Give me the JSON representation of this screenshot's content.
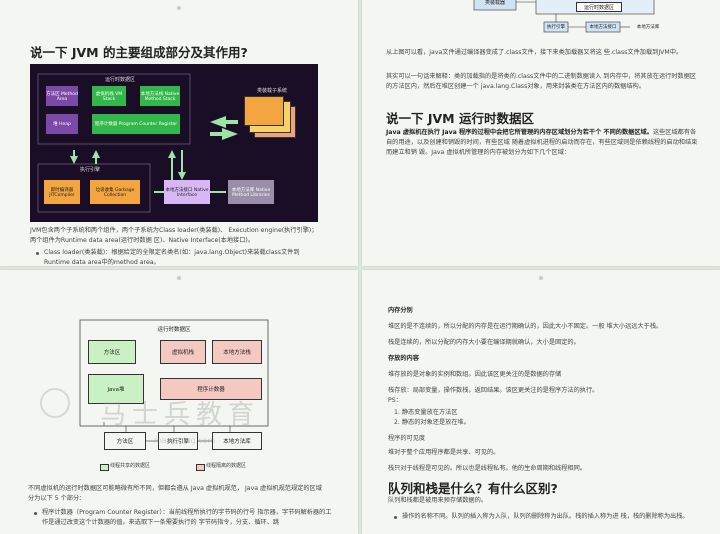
{
  "page1": {
    "title": "说一下 JVM 的主要组成部分及其作用?",
    "diagram": {
      "runtime_area": "运行时数据区",
      "method_area": "方法区 Method Area",
      "vm_stack": "虚拟机栈 VM Stack",
      "native_stack": "本地方法栈 Native Method Stack",
      "heap": "堆 Heap",
      "pc_register": "程序计数器 Program Counter Register",
      "class_loader": "类装载子系统",
      "exec_engine": "执行引擎",
      "jit": "即时编译器 JITCompiler",
      "gc": "垃圾收集 Garbage Collection",
      "native_interface": "本地方法接口 Native Interface",
      "native_lib": "本地方法库 Native Method Libraries"
    },
    "para": "JVM包含两个子系统和两个组件，两个子系统为Class loader(类装载)、 Execution engine(执行引擎)；两个组件为Runtime data area(运行时数据 区)、Native Interface(本地接口)。",
    "bullet": "Class loader(类装载)：根据给定的全限定名类名(如：java.lang.Object)来装载class文件到 Runtime data area中的method area。"
  },
  "page2": {
    "top_boxes": {
      "class_loader": "类装载器",
      "runtime": "运行时数据区",
      "exec": "执行引擎",
      "native_iface": "本地方法接口",
      "native_lib": "本地方法库"
    },
    "para1": "从上图可以看，java文件通过编译器变成了.class文件，接下来类加载器又将这 些.class文件加载到JVM中。",
    "para2": "其实可以一句话来解释：类的加载指的是将类的.class文件中的二进制数据读入 到内存中，将其放在运行时数据区的方法区内，然后在堆区创建一个 java.lang.Class对象，用来封装类在方法区内的数据结构。",
    "title": "说一下 JVM 运行时数据区",
    "para3_bold": "Java 虚拟机在执行 Java 程序的过程中会把它所管理的内存区域划分为若干个 不同的数据区域。",
    "para3": "这些区域都有各自的用途，以及创建和销毁的时间，有些区域 随着虚拟机进程的启动而存在，有些区域则是依赖线程的启动和结束而建立和销 毁。Java 虚拟机所管理的内存被划分为如下几个区域："
  },
  "page3": {
    "diagram": {
      "runtime_area": "运行时数据区",
      "method_area": "方法区",
      "vm_stack": "虚拟机栈",
      "native_stack": "本地方法栈",
      "heap": "Java堆",
      "pc": "程序计数器",
      "bottom_method": "方法区",
      "bottom_exec": "执行引擎",
      "bottom_native": "本地方法库",
      "legend_shared": "线程共享的数据区",
      "legend_private": "线程隔离的数据区"
    },
    "watermark": "马士兵教育",
    "watermark_url": "mashibing.com",
    "para": "不同虚拟机的运行时数据区可能略微有所不同，但都会遵从 Java 虚拟机规范， Java 虚拟机规范规定的区域分为以下 5 个部分：",
    "bullet": "程序计数器（Program Counter Register）：当前线程所执行的字节码的行号 指示器，字节码解析器的工作是通过改变这个计数器的值，来选取下一条需要执行的 字节码指令，分支、循环、跳"
  },
  "page4": {
    "h_mem": "内存分别",
    "l1": "堆区的是不连续的，所以分配的内存是在运行期确认的，因此大小不固定。一般 堆大小远远大于栈。",
    "l2": "栈是连续的，所以分配的内存大小要在编译期就确认，大小是固定的。",
    "h_store": "存放的内容",
    "l3": "堆存放的是对象的实例和数组。因此该区更关注的是数据的存储",
    "l4": "栈存放：局部变量，操作数栈，返回结果。该区更关注的是程序方法的执行。",
    "ps": "PS：",
    "n1": "1. 静态变量放在方法区",
    "n2": "2. 静态的对象还是放在堆。",
    "h_vis": "程序的可见度",
    "l5": "堆对于整个应用程序都是共享、可见的。",
    "l6": "栈只对于线程是可见的。所以也是线程私有。他的生命周期和线程相同。",
    "title": "队列和栈是什么？有什么区别?",
    "l7": "队列和栈都是被用来预存储数据的。",
    "bullet": "操作的名称不同。队列的插入称为入队，队列的删除称为出队。栈的插入称为进 栈，栈的删除称为出栈。"
  }
}
